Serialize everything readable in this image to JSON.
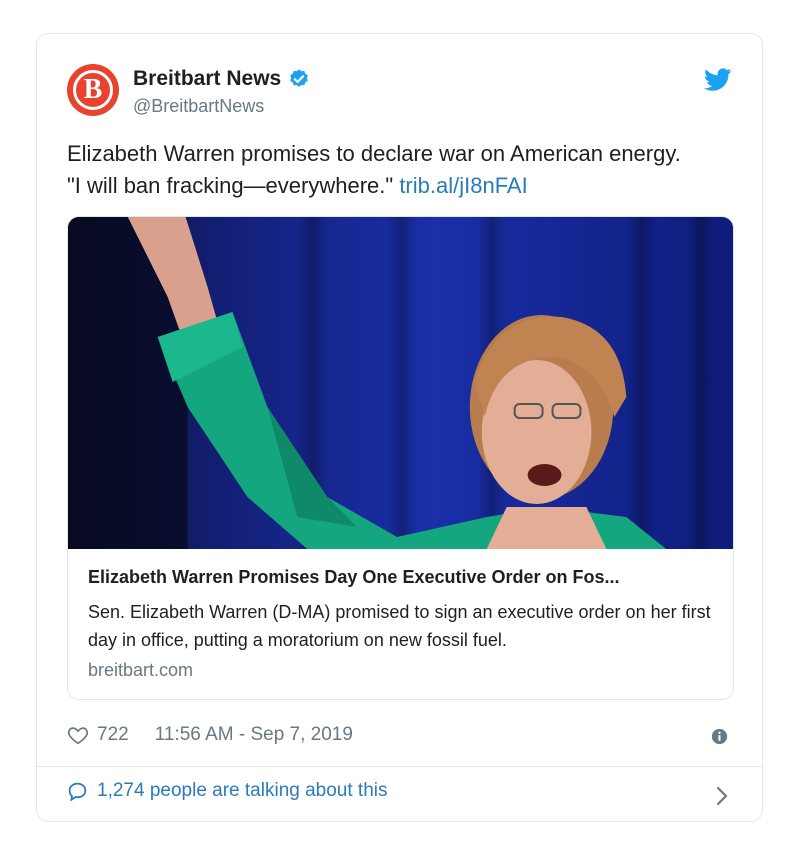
{
  "author": {
    "display_name": "Breitbart News",
    "handle": "@BreitbartNews",
    "avatar_letter": "B",
    "avatar_color": "#e8432f",
    "verified": true
  },
  "tweet": {
    "text_line1": "Elizabeth Warren promises to declare war on American energy.",
    "text_line2": "\"I will ban fracking—everywhere.\"",
    "link": "trib.al/jI8nFAI"
  },
  "link_card": {
    "image_desc": "photo",
    "title": "Elizabeth Warren Promises Day One Executive Order on Fos...",
    "description": "Sen. Elizabeth Warren (D-MA) promised to sign an executive order on her first day in office, putting a moratorium on new fossil fuel.",
    "domain": "breitbart.com"
  },
  "meta": {
    "like_count": "722",
    "timestamp": "11:56 AM - Sep 7, 2019"
  },
  "footer": {
    "talking_label": "1,274 people are talking about this"
  },
  "colors": {
    "link": "#2b7bb9",
    "twitter_blue": "#1da1f2",
    "muted": "#697882",
    "border": "#e1e8ed"
  },
  "icons": [
    "twitter-bird-icon",
    "verified-badge-icon",
    "heart-icon",
    "info-icon",
    "comment-bubble-icon",
    "chevron-right-icon"
  ]
}
